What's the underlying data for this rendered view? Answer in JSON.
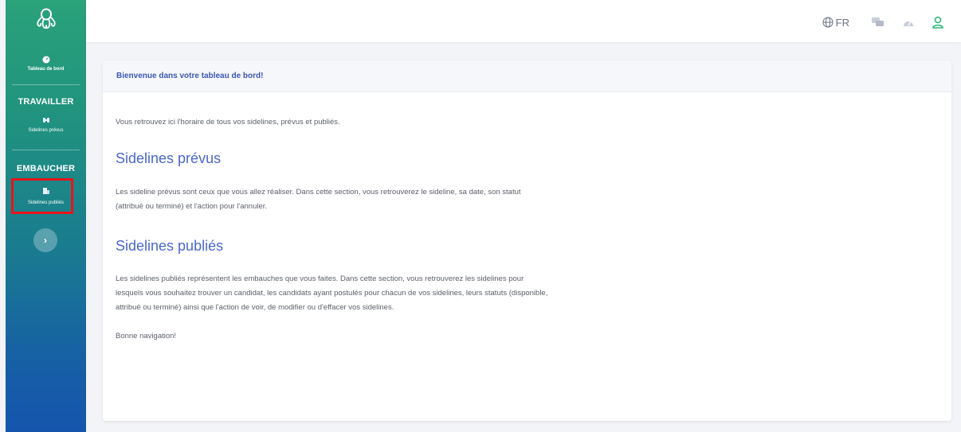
{
  "sidebar": {
    "logo_icon": "octopus-logo-icon",
    "dashboard": {
      "icon": "dashboard-gauge-icon",
      "label": "Tableau de bord"
    },
    "sections": [
      {
        "title": "TRAVAILLER",
        "item": {
          "icon": "binoculars-icon",
          "label": "Sidelines prévus"
        }
      },
      {
        "title": "EMBAUCHER",
        "item": {
          "icon": "building-icon",
          "label": "Sidelines publiés"
        }
      }
    ],
    "expand_icon": "chevron-right-icon",
    "highlight_color": "#e8141b"
  },
  "topbar": {
    "language": "FR",
    "icons": [
      "globe-icon",
      "chat-icon",
      "dashboard-icon",
      "user-icon"
    ]
  },
  "card": {
    "header": "Bienvenue dans votre tableau de bord!",
    "intro": "Vous retrouvez ici l'horaire de tous vos sidelines, prévus et publiés.",
    "section1": {
      "title": "Sidelines prévus",
      "text": "Les sideline prévus sont ceux que vous allez réaliser. Dans cette section, vous retrouverez le sideline, sa date, son statut (attribué ou terminé) et l'action pour l'annuler."
    },
    "section2": {
      "title": "Sidelines publiés",
      "text": "Les sidelines publiés représentent les embauches que vous faites. Dans cette section, vous retrouverez les sidelines pour lesquels vous souhaitez trouver un candidat, les candidats ayant postulés pour chacun de vos sidelines, leurs statuts (disponible, attribué ou terminé) ainsi que l'action de voir, de modifier ou d'effacer vos sidelines."
    },
    "closing": "Bonne navigation!"
  },
  "colors": {
    "sidebar_top": "#2aa27a",
    "sidebar_bottom": "#1556ad",
    "heading_blue": "#4a68c9",
    "header_blue": "#3d56b3",
    "user_icon_green": "#2bb673"
  }
}
